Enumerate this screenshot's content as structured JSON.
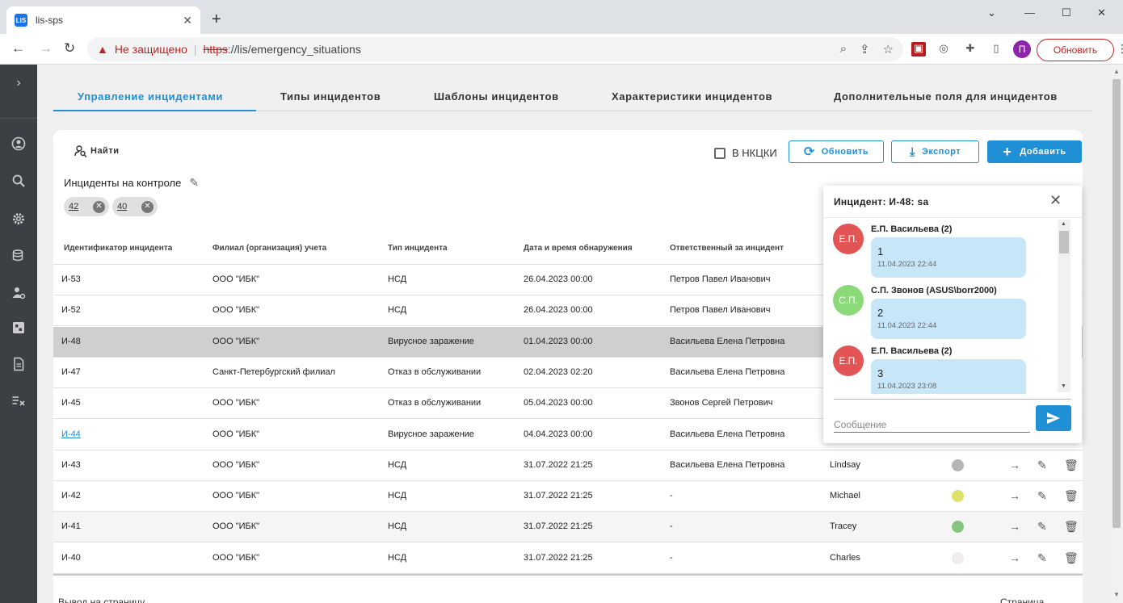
{
  "browser": {
    "tab_title": "lis-sps",
    "favicon_text": "LIS",
    "insecure_label": "Не защищено",
    "url_scheme": "https",
    "url_rest": "://lis/emergency_situations",
    "profile_initial": "П",
    "update_label": "Обновить"
  },
  "tabs": [
    {
      "label": "Управление инцидентами",
      "active": true
    },
    {
      "label": "Типы инцидентов",
      "active": false
    },
    {
      "label": "Шаблоны инцидентов",
      "active": false
    },
    {
      "label": "Характеристики инцидентов",
      "active": false
    },
    {
      "label": "Дополнительные поля для инцидентов",
      "active": false
    }
  ],
  "toolbar": {
    "find_label": "Найти",
    "nkcki_label": "В НКЦКИ",
    "refresh_label": "Обновить",
    "export_label": "Экспорт",
    "add_label": "Добавить"
  },
  "control": {
    "title": "Инциденты на контроле",
    "chips": [
      "42",
      "40"
    ]
  },
  "table": {
    "headers": [
      "Идентификатор инцидента",
      "Филиал (организация) учета",
      "Тип инцидента",
      "Дата и время обнаружения",
      "Ответственный за инцидент"
    ],
    "rows": [
      {
        "id": "И-53",
        "branch": "ООО \"ИБК\"",
        "type": "НСД",
        "date": "26.04.2023 00:00",
        "resp": "Петров Павел Иванович",
        "assignee": "",
        "status": ""
      },
      {
        "id": "И-52",
        "branch": "ООО \"ИБК\"",
        "type": "НСД",
        "date": "26.04.2023 00:00",
        "resp": "Петров Павел Иванович",
        "assignee": "",
        "status": ""
      },
      {
        "id": "И-48",
        "branch": "ООО \"ИБК\"",
        "type": "Вирусное заражение",
        "date": "01.04.2023 00:00",
        "resp": "Васильева Елена Петровна",
        "assignee": "",
        "status": ""
      },
      {
        "id": "И-47",
        "branch": "Санкт-Петербургский филиал",
        "type": "Отказ в обслуживании",
        "date": "02.04.2023 02:20",
        "resp": "Васильева Елена Петровна",
        "assignee": "",
        "status": ""
      },
      {
        "id": "И-45",
        "branch": "ООО \"ИБК\"",
        "type": "Отказ в обслуживании",
        "date": "05.04.2023 00:00",
        "resp": "Звонов Сергей Петрович",
        "assignee": "",
        "status": ""
      },
      {
        "id": "И-44",
        "branch": "ООО \"ИБК\"",
        "type": "Вирусное заражение",
        "date": "04.04.2023 00:00",
        "resp": "Васильева Елена Петровна",
        "assignee": "",
        "status": ""
      },
      {
        "id": "И-43",
        "branch": "ООО \"ИБК\"",
        "type": "НСД",
        "date": "31.07.2022 21:25",
        "resp": "Васильева Елена Петровна",
        "assignee": "Lindsay",
        "status": "#b5b5b5"
      },
      {
        "id": "И-42",
        "branch": "ООО \"ИБК\"",
        "type": "НСД",
        "date": "31.07.2022 21:25",
        "resp": "-",
        "assignee": "Michael",
        "status": "#dde36a"
      },
      {
        "id": "И-41",
        "branch": "ООО \"ИБК\"",
        "type": "НСД",
        "date": "31.07.2022 21:25",
        "resp": "-",
        "assignee": "Tracey",
        "status": "#86c580"
      },
      {
        "id": "И-40",
        "branch": "ООО \"ИБК\"",
        "type": "НСД",
        "date": "31.07.2022 21:25",
        "resp": "-",
        "assignee": "Charles",
        "status": "#f0eced"
      }
    ]
  },
  "pager": {
    "left": "Вывод на страницу",
    "right": "Страница"
  },
  "chat": {
    "title": "Инцидент: И-48: sa",
    "messages": [
      {
        "initials": "Е.П.",
        "author": "Е.П. Васильева (2)",
        "text": "1",
        "time": "11.04.2023 22:44",
        "color": "#e35454"
      },
      {
        "initials": "С.П.",
        "author": "С.П. Звонов (ASUS\\borr2000)",
        "text": "2",
        "time": "11.04.2023 22:44",
        "color": "#8cd97a"
      },
      {
        "initials": "Е.П.",
        "author": "Е.П. Васильева (2)",
        "text": "3",
        "time": "11.04.2023 23:08",
        "color": "#e35454"
      }
    ],
    "input_placeholder": "Сообщение"
  },
  "colors": {
    "accent": "#1f8fd6",
    "sidebar": "#3c3f44",
    "selected_row": "#cfcfcf"
  }
}
